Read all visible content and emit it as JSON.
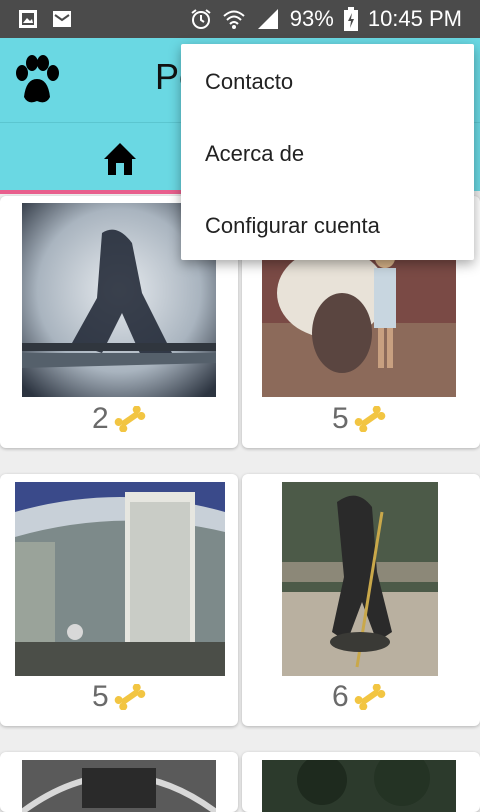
{
  "status_bar": {
    "battery": "93%",
    "time": "10:45 PM",
    "icons": [
      "image-icon",
      "mail-icon",
      "alarm-icon",
      "wifi-icon",
      "signal-icon",
      "battery-icon"
    ]
  },
  "app_bar": {
    "title_partial": "Pe",
    "logo_icon": "paw-icon"
  },
  "tabs": {
    "home_icon": "home-icon",
    "indicator_color": "#e85f8d"
  },
  "colors": {
    "app_bar_bg": "#6ad8e3",
    "bone": "#f2c542"
  },
  "posts": [
    {
      "likes": "2"
    },
    {
      "likes": "5"
    },
    {
      "likes": "5"
    },
    {
      "likes": "6"
    }
  ],
  "overflow_menu": {
    "items": [
      "Contacto",
      "Acerca de",
      "Configurar cuenta"
    ]
  }
}
